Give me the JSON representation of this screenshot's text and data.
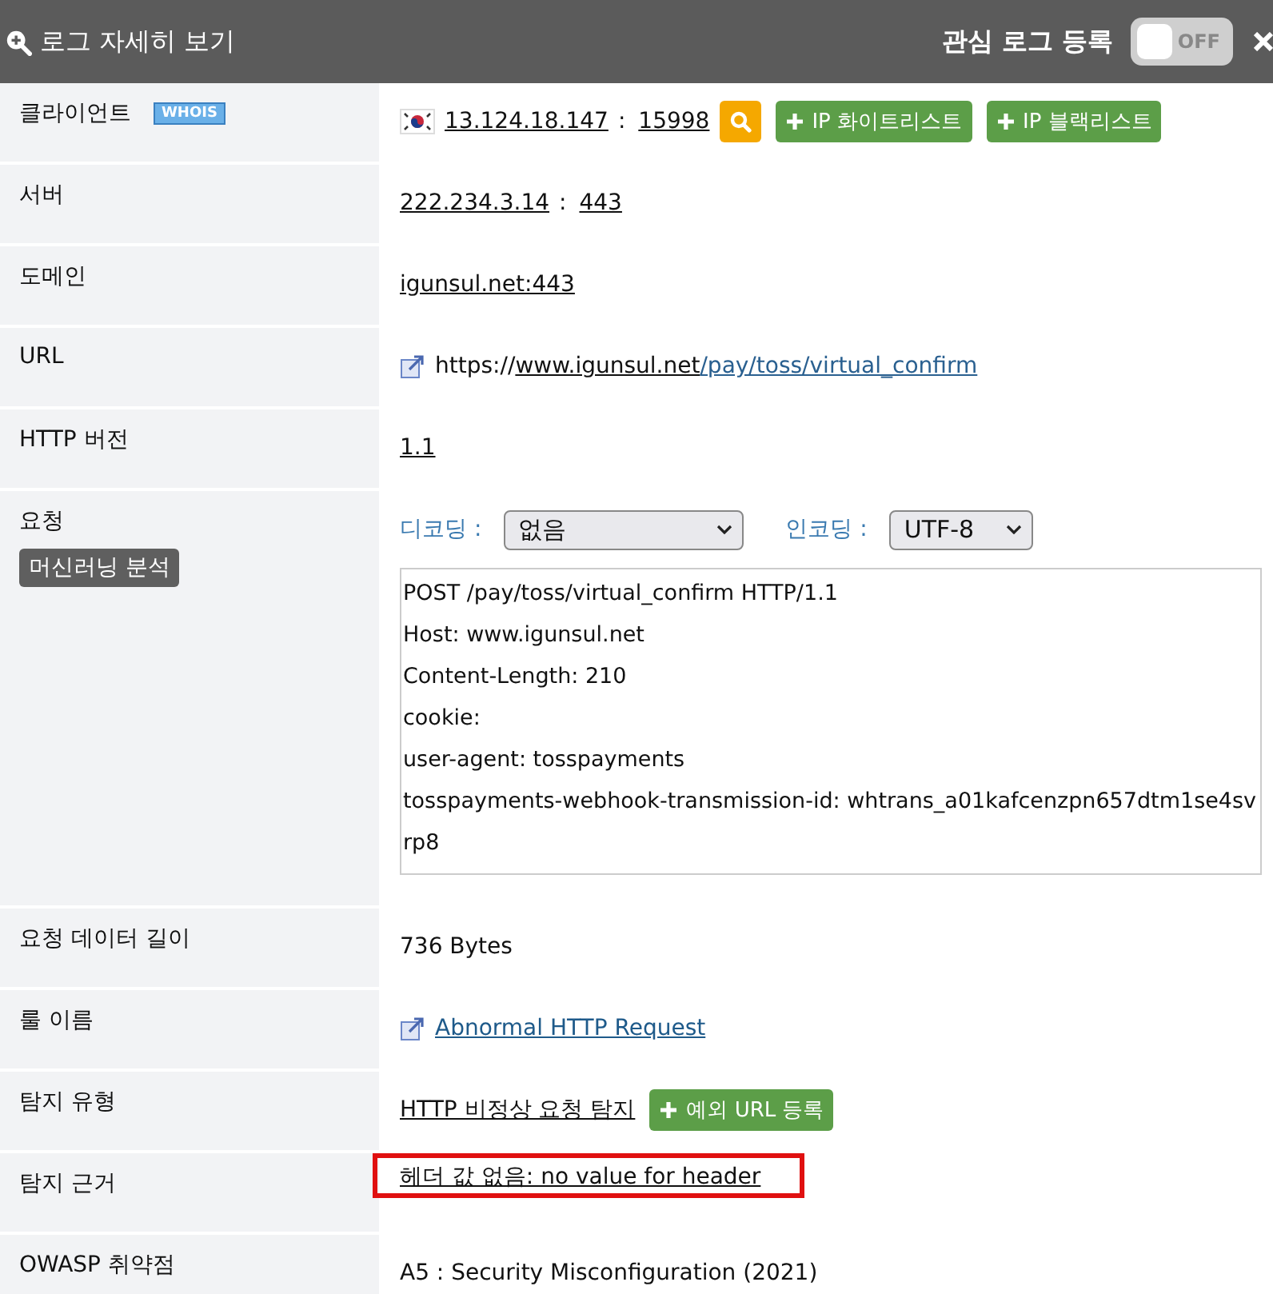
{
  "header": {
    "title": "로그 자세히 보기",
    "watch_label": "관심 로그 등록",
    "toggle": {
      "label": "OFF",
      "on": false
    }
  },
  "rows": [
    {
      "kind": "endpoint",
      "label": "클라이언트",
      "badge": "WHOIS",
      "flag": true,
      "host": "13.124.18.147",
      "separator": ":",
      "port": "15998",
      "search": true,
      "buttons": [
        "IP 화이트리스트",
        "IP 블랙리스트"
      ]
    },
    {
      "kind": "endpoint",
      "label": "서버",
      "host": "222.234.3.14",
      "separator": ":",
      "port": "443"
    },
    {
      "kind": "underlined",
      "label": "도메인",
      "value": "igunsul.net:443"
    },
    {
      "kind": "url",
      "label": "URL",
      "scheme": "https://",
      "host": "www.igunsul.net",
      "path": "/pay/toss/virtual_confirm"
    },
    {
      "kind": "underlined",
      "label": "HTTP 버전",
      "value": "1.1"
    },
    {
      "kind": "request",
      "label": "요청",
      "action": "머신러닝 분석",
      "decoding_label": "디코딩 :",
      "decoding": "없음",
      "encoding_label": "인코딩 :",
      "encoding": "UTF-8",
      "lines": [
        "POST /pay/toss/virtual_confirm HTTP/1.1",
        "Host: www.igunsul.net",
        "Content-Length: 210",
        "cookie:",
        "user-agent: tosspayments",
        "tosspayments-webhook-transmission-id: whtrans_a01kafcenzpn657dtm1se4svrp8"
      ]
    },
    {
      "kind": "plain",
      "label": "요청 데이터 길이",
      "value": "736 Bytes"
    },
    {
      "kind": "rule",
      "label": "룰 이름",
      "value": "Abnormal HTTP Request"
    },
    {
      "kind": "detect",
      "label": "탐지 유형",
      "value": "HTTP 비정상 요청 탐지",
      "button": "예외 URL 등록"
    },
    {
      "kind": "underlined",
      "label": "탐지 근거",
      "value": "헤더 값 없음: no value for header",
      "highlighted": true
    },
    {
      "kind": "plain",
      "label": "OWASP 취약점",
      "value": "A5 : Security Misconfiguration (2021)"
    }
  ]
}
